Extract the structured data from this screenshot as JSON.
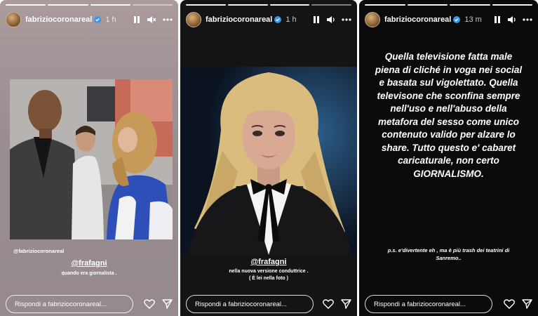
{
  "stories": [
    {
      "username": "fabriziocoronareal",
      "time": "1 h",
      "credit": "@fabriziocoronareal",
      "mention": "@frafagni",
      "caption": "quando era giornalista .",
      "reply_placeholder": "Rispondi a fabriziocoronareal..."
    },
    {
      "username": "fabriziocoronareal",
      "time": "1 h",
      "mention": "@frafagni",
      "caption_line1": "nella nuova versione conduttrice .",
      "caption_line2": "( È lei nella foto )",
      "reply_placeholder": "Rispondi a fabriziocoronareal..."
    },
    {
      "username": "fabriziocoronareal",
      "time": "13 m",
      "main_text": "Quella televisione fatta male piena di cliché in voga nei social e basata sul vigolettato. Quella televisone che sconfina sempre nell'uso e nell'abuso della metafora del sesso come unico contenuto valido per alzare lo share. Tutto questo e' cabaret caricaturale, non certo GIORNALISMO.",
      "ps_text": "p.s. e'divertente eh , ma è più trash dei teatrini di Sanremo..",
      "reply_placeholder": "Rispondi a fabriziocoronareal..."
    }
  ],
  "icons": [
    "pause-icon",
    "mute-icon",
    "volume-icon",
    "more-icon",
    "heart-icon",
    "send-icon",
    "verified-icon"
  ],
  "colors": {
    "text": "#ffffff",
    "story1_bg": "#9a8d90",
    "story2_bg": "#141414",
    "story3_bg": "#0b0b0b"
  }
}
